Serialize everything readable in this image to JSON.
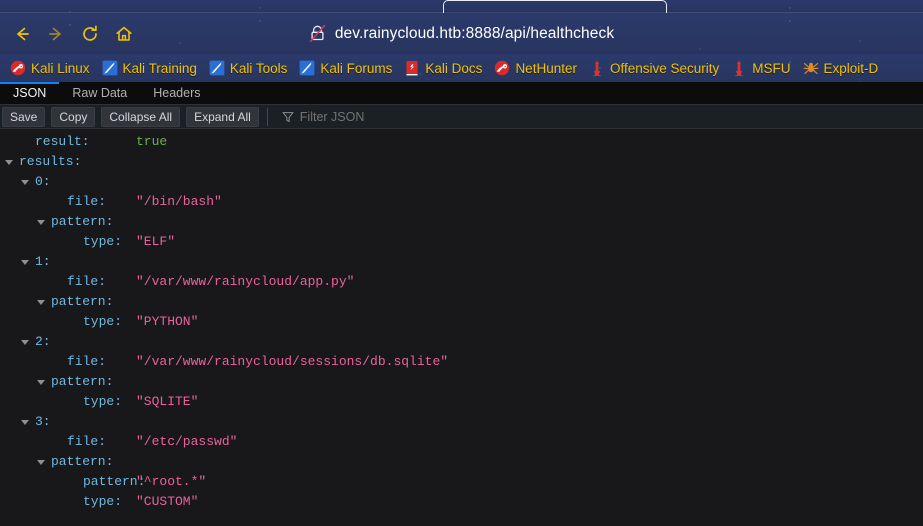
{
  "browser": {
    "accent_color": "#0a84ff",
    "chrome_color": "#2b3a6b",
    "bookmark_text_color": "#f2c200",
    "nav": {
      "back_label": "Back",
      "forward_label": "Forward",
      "reload_label": "Reload",
      "home_label": "Home"
    },
    "address": {
      "url": "dev.rainycloud.htb:8888/api/healthcheck",
      "security_icon": "lock-slash-icon",
      "security_state": "insecure"
    },
    "bookmarks": [
      {
        "label": "Kali Linux",
        "icon": "kali-dragon-icon"
      },
      {
        "label": "Kali Training",
        "icon": "kali-knife-icon"
      },
      {
        "label": "Kali Tools",
        "icon": "kali-knife-icon"
      },
      {
        "label": "Kali Forums",
        "icon": "kali-knife-icon"
      },
      {
        "label": "Kali Docs",
        "icon": "kali-book-icon"
      },
      {
        "label": "NetHunter",
        "icon": "kali-dragon-icon"
      },
      {
        "label": "Offensive Security",
        "icon": "metasploit-icon"
      },
      {
        "label": "MSFU",
        "icon": "metasploit-icon"
      },
      {
        "label": "Exploit-D",
        "icon": "exploitdb-spider-icon"
      }
    ]
  },
  "viewer": {
    "tabs": [
      {
        "label": "JSON",
        "active": true
      },
      {
        "label": "Raw Data",
        "active": false
      },
      {
        "label": "Headers",
        "active": false
      }
    ],
    "toolbar": {
      "save_label": "Save",
      "copy_label": "Copy",
      "collapse_all_label": "Collapse All",
      "expand_all_label": "Expand All",
      "filter_placeholder": "Filter JSON",
      "filter_value": "",
      "filter_icon": "funnel-icon"
    },
    "rows": [
      {
        "indent": 1,
        "twisty": false,
        "key": "result:",
        "value": "true",
        "type": "boolean"
      },
      {
        "indent": 0,
        "twisty": true,
        "key": "results:",
        "value": "",
        "type": "none"
      },
      {
        "indent": 1,
        "twisty": true,
        "key": "0:",
        "value": "",
        "type": "none"
      },
      {
        "indent": 3,
        "twisty": false,
        "key": "file:",
        "value": "\"/bin/bash\"",
        "type": "string"
      },
      {
        "indent": 2,
        "twisty": true,
        "key": "pattern:",
        "value": "",
        "type": "none"
      },
      {
        "indent": 4,
        "twisty": false,
        "key": "type:",
        "value": "\"ELF\"",
        "type": "string"
      },
      {
        "indent": 1,
        "twisty": true,
        "key": "1:",
        "value": "",
        "type": "none"
      },
      {
        "indent": 3,
        "twisty": false,
        "key": "file:",
        "value": "\"/var/www/rainycloud/app.py\"",
        "type": "string"
      },
      {
        "indent": 2,
        "twisty": true,
        "key": "pattern:",
        "value": "",
        "type": "none"
      },
      {
        "indent": 4,
        "twisty": false,
        "key": "type:",
        "value": "\"PYTHON\"",
        "type": "string"
      },
      {
        "indent": 1,
        "twisty": true,
        "key": "2:",
        "value": "",
        "type": "none"
      },
      {
        "indent": 3,
        "twisty": false,
        "key": "file:",
        "value": "\"/var/www/rainycloud/sessions/db.sqlite\"",
        "type": "string"
      },
      {
        "indent": 2,
        "twisty": true,
        "key": "pattern:",
        "value": "",
        "type": "none"
      },
      {
        "indent": 4,
        "twisty": false,
        "key": "type:",
        "value": "\"SQLITE\"",
        "type": "string"
      },
      {
        "indent": 1,
        "twisty": true,
        "key": "3:",
        "value": "",
        "type": "none"
      },
      {
        "indent": 3,
        "twisty": false,
        "key": "file:",
        "value": "\"/etc/passwd\"",
        "type": "string"
      },
      {
        "indent": 2,
        "twisty": true,
        "key": "pattern:",
        "value": "",
        "type": "none"
      },
      {
        "indent": 4,
        "twisty": false,
        "key": "pattern:",
        "value": "\"^root.*\"",
        "type": "string"
      },
      {
        "indent": 4,
        "twisty": false,
        "key": "type:",
        "value": "\"CUSTOM\"",
        "type": "string"
      }
    ]
  }
}
